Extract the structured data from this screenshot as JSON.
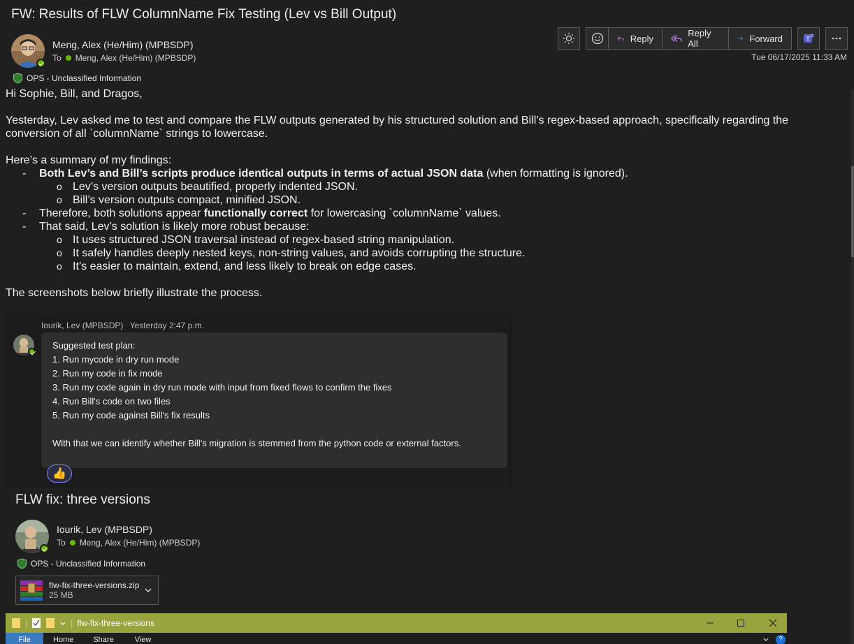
{
  "email": {
    "subject": "FW: Results of FLW ColumnName Fix Testing (Lev vs Bill Output)",
    "sender": "Meng, Alex (He/Him) (MPBSDP)",
    "to_label": "To",
    "to_name": "Meng, Alex (He/Him) (MPBSDP)",
    "date": "Tue 06/17/2025 11:33 AM",
    "classification": "OPS - Unclassified Information"
  },
  "toolbar": {
    "reply": "Reply",
    "reply_all": "Reply All",
    "forward": "Forward"
  },
  "body": {
    "greeting": "Hi Sophie, Bill, and Dragos,",
    "intro": "Yesterday, Lev asked me to test and compare the FLW outputs generated by his structured solution and Bill’s regex-based approach, specifically regarding the conversion of all `columnName` strings to lowercase.",
    "summary_intro": "Here’s a summary of my findings:",
    "b1_bold": "Both Lev’s and Bill’s scripts produce identical outputs in terms of actual JSON data",
    "b1_rest": " (when formatting is ignored).",
    "b1_sub1": "Lev’s version outputs beautified, properly indented JSON.",
    "b1_sub2": "Bill’s version outputs compact, minified JSON.",
    "b2_pre": "Therefore, both solutions appear ",
    "b2_bold": "functionally correct",
    "b2_post": " for lowercasing `columnName` values.",
    "b3": "That said, Lev’s solution is likely more robust because:",
    "b3_sub1": "It uses structured JSON traversal instead of regex-based string manipulation.",
    "b3_sub2": "It safely handles deeply nested keys, non-string values, and avoids corrupting the structure.",
    "b3_sub3": "It’s easier to maintain, extend, and less likely to break on edge cases.",
    "closing": "The screenshots below briefly illustrate the process."
  },
  "teams_card": {
    "author": "Iourik, Lev (MPBSDP)",
    "time": "Yesterday 2:47 p.m.",
    "line0": "Suggested test plan:",
    "line1": "1. Run mycode in dry run mode",
    "line2": "2. Run my code in fix mode",
    "line3": "3. Run my code again in dry run mode with input from fixed flows to confirm the fixes",
    "line4": "4. Run Bill's code on two files",
    "line5": "5. Run my code against Bill's fix results",
    "line6": "With that we can identify whether Bill's migration is stemmed from the python code or external factors.",
    "reaction": "👍"
  },
  "embedded_email": {
    "subject": "FLW fix: three versions",
    "sender": "Iourik, Lev (MPBSDP)",
    "to_label": "To",
    "to_name": "Meng, Alex (He/Him) (MPBSDP)",
    "classification": "OPS - Unclassified Information",
    "attachment_name": "flw-fix-three-versions.zip",
    "attachment_size": "25 MB"
  },
  "explorer": {
    "title": "flw-fix-three-versions",
    "tab_file": "File",
    "tab_home": "Home",
    "tab_share": "Share",
    "tab_view": "View"
  },
  "colors": {
    "background": "#1f1f1f",
    "presence": "#6bb700",
    "explorer_title": "#9aa43e",
    "accent": "#7f85f5"
  }
}
